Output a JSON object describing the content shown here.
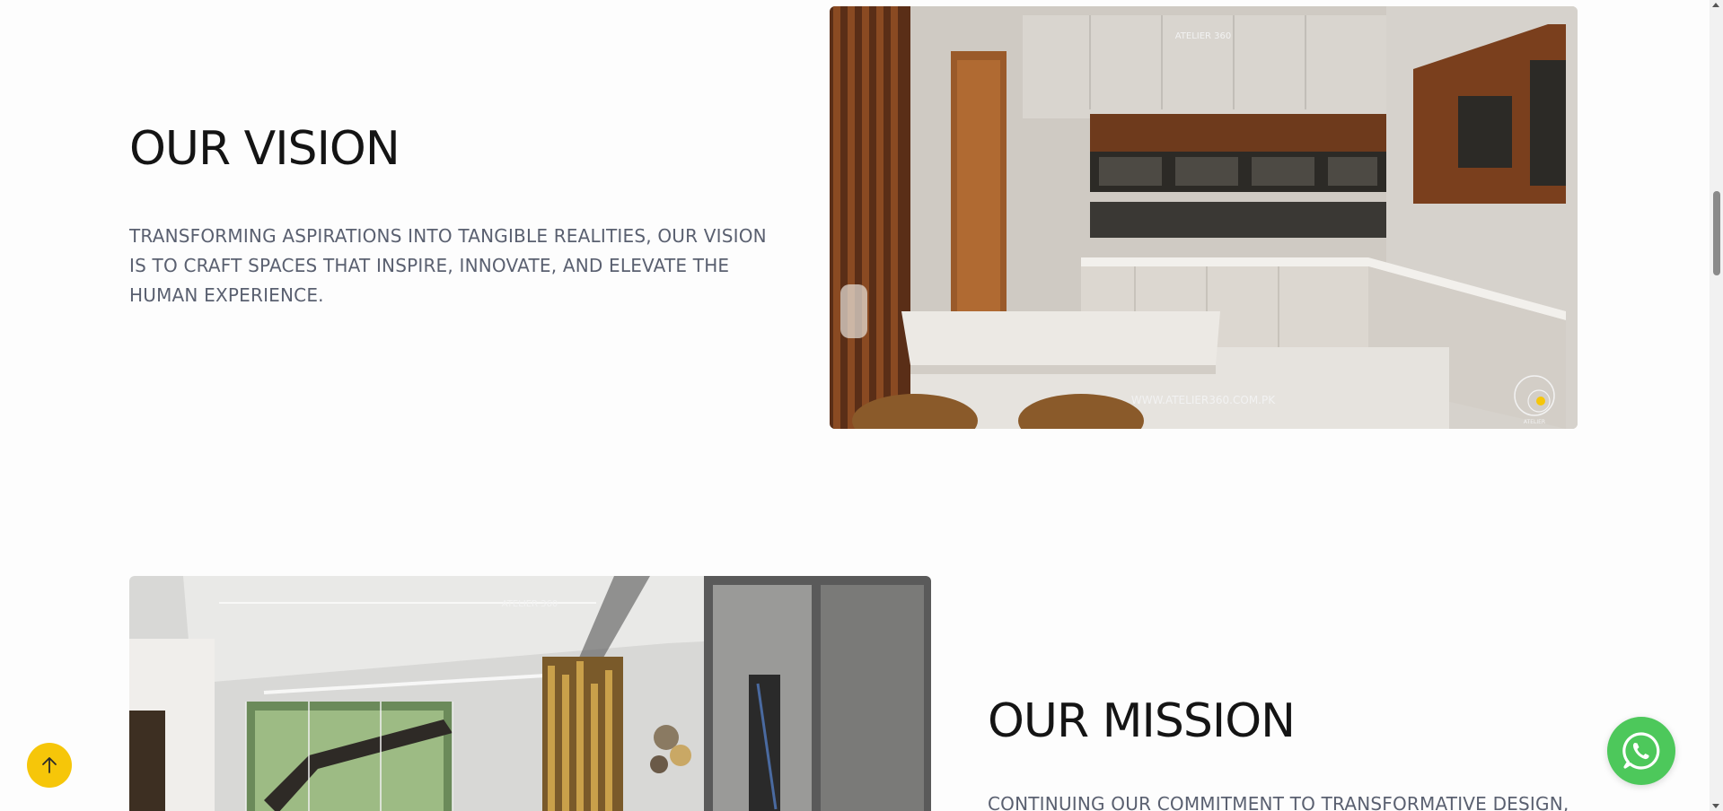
{
  "vision": {
    "heading": "OUR VISION",
    "text": "TRANSFORMING ASPIRATIONS INTO TANGIBLE REALITIES, OUR VISION IS TO CRAFT SPACES THAT INSPIRE, INNOVATE, AND ELEVATE THE HUMAN EXPERIENCE.",
    "image": {
      "brand": "ATELIER 360",
      "url_text": "WWW.ATELIER360.COM.PK",
      "logo_text": "ATELIER"
    }
  },
  "mission": {
    "heading": "OUR MISSION",
    "text": "CONTINUING OUR COMMITMENT TO TRANSFORMATIVE DESIGN,",
    "image": {
      "brand": "ATELIER 360"
    }
  },
  "floating": {
    "scroll_top_icon": "arrow-up-icon",
    "whatsapp_icon": "whatsapp-icon"
  },
  "colors": {
    "accent_yellow": "#f6c609",
    "whatsapp_green": "#4dc85b",
    "heading": "#141414",
    "body_text": "#5a6070"
  }
}
